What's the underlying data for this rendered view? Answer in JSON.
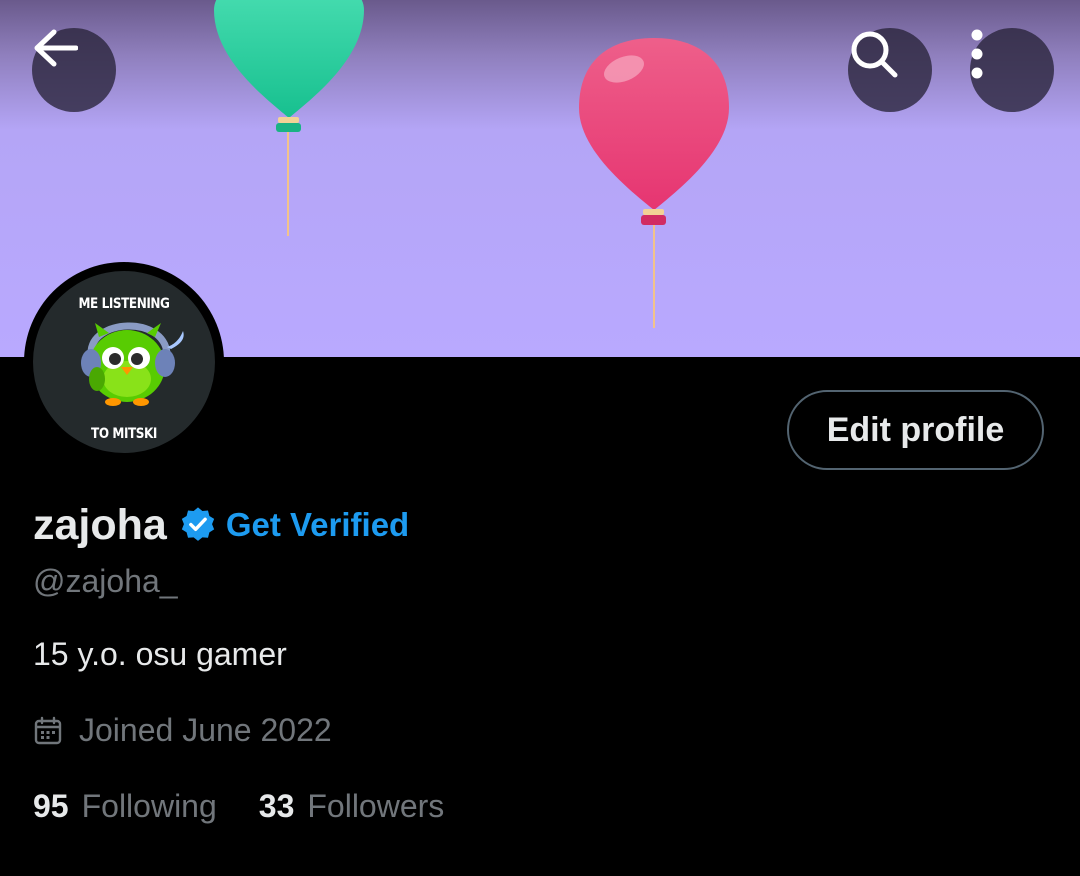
{
  "header": {
    "back_icon": "arrow-left-icon",
    "search_icon": "search-icon",
    "more_icon": "more-vertical-icon",
    "banner_color": "#b9a9ff"
  },
  "avatar": {
    "caption_top": "ME LISTENING",
    "caption_bottom": "TO MITSKI"
  },
  "profile": {
    "edit_label": "Edit profile",
    "display_name": "zajoha",
    "verified_icon": "verified-badge-icon",
    "get_verified_label": "Get Verified",
    "handle": "@zajoha_",
    "bio": "15 y.o. osu gamer",
    "joined_icon": "calendar-icon",
    "joined": "Joined June 2022",
    "following_count": "95",
    "following_label": "Following",
    "followers_count": "33",
    "followers_label": "Followers"
  },
  "colors": {
    "accent": "#1d9bf0",
    "text_primary": "#e7e9ea",
    "text_secondary": "#71767b",
    "background": "#000000"
  }
}
